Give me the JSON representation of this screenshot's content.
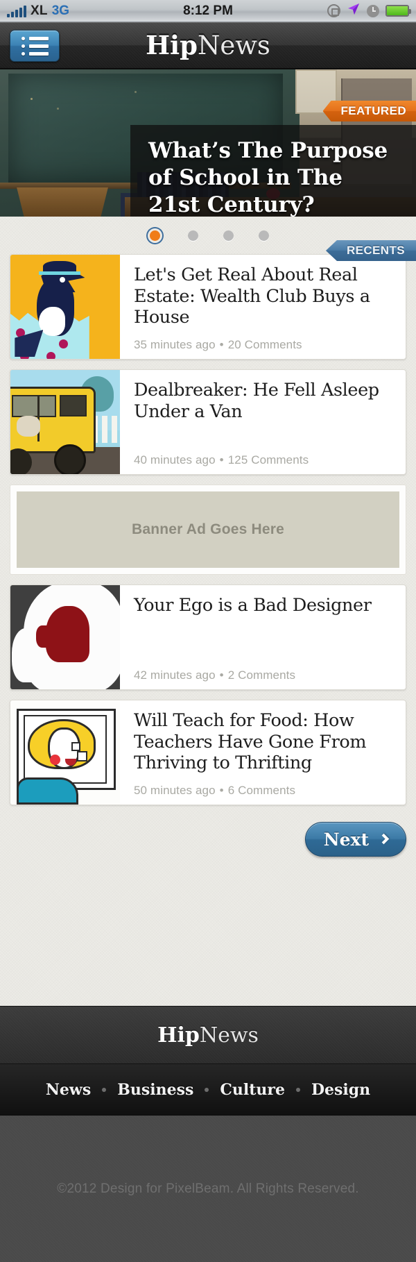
{
  "status_bar": {
    "carrier": "XL",
    "network": "3G",
    "time": "8:12 PM",
    "icons": [
      "signal-bars-icon",
      "rotation-lock-icon",
      "location-arrow-icon",
      "alarm-clock-icon",
      "battery-icon"
    ]
  },
  "nav": {
    "menu_icon": "list-menu-icon",
    "brand_bold": "Hip",
    "brand_light": "News"
  },
  "hero": {
    "badge": "FEATURED",
    "title": "What’s The Purpose of School in The 21st Century?"
  },
  "carousel": {
    "total_dots": 4,
    "active_index": 0
  },
  "recents": {
    "ribbon_label": "RECENTS"
  },
  "articles": [
    {
      "title": "Let's Get Real About Real Estate: Wealth Club Buys a House",
      "time": "35 minutes ago",
      "separator": "•",
      "comments": "20 Comments",
      "thumb": "bird-in-egg-illustration"
    },
    {
      "title": "Dealbreaker: He Fell Asleep Under a Van",
      "time": "40 minutes ago",
      "separator": "•",
      "comments": "125 Comments",
      "thumb": "yellow-van-illustration"
    },
    {
      "title": "Your Ego is a Bad Designer",
      "time": "42 minutes ago",
      "separator": "•",
      "comments": "2 Comments",
      "thumb": "head-silhouette-illustration"
    },
    {
      "title": "Will Teach for Food: How Teachers Have Gone From Thriving to Thrifting",
      "time": "50 minutes ago",
      "separator": "•",
      "comments": "6 Comments",
      "thumb": "teacher-cartoon-illustration"
    }
  ],
  "ad": {
    "label": "Banner Ad Goes Here"
  },
  "pagination": {
    "next_label": "Next",
    "next_icon": "chevron-right-icon"
  },
  "footer": {
    "brand_bold": "Hip",
    "brand_light": "News",
    "nav": [
      "News",
      "Business",
      "Culture",
      "Design"
    ],
    "nav_separator": "•",
    "copyright": "©2012 Design for PixelBeam. All Rights Reserved."
  },
  "colors": {
    "featured_orange": "#e4701a",
    "recents_blue": "#4a7ba6",
    "active_dot": "#f07d18",
    "button_blue": "#3c7aa6",
    "page_bg": "#ecebe6"
  }
}
